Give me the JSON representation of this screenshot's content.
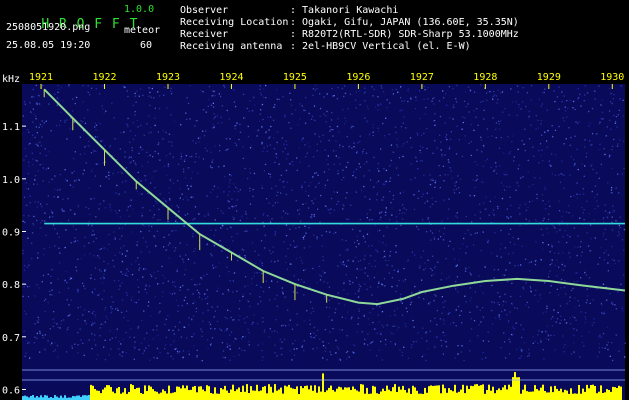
{
  "app": {
    "name": "H R O F F T",
    "version": "1.0.0"
  },
  "file": {
    "name": "2508051920.png",
    "datetime": "25.08.05 19:20"
  },
  "mode": {
    "label": "meteor",
    "value": "60"
  },
  "info": {
    "labels": [
      "Observer",
      "Receiving Location",
      "Receiver",
      "Receiving antenna"
    ],
    "values": [
      ": Takanori Kawachi",
      ": Ogaki, Gifu, JAPAN (136.60E, 35.35N)",
      ": R820T2(RTL-SDR) SDR-Sharp 53.1000MHz",
      ": 2el-HB9CV Vertical (el. E-W)"
    ]
  },
  "colors": {
    "background": "#0a0a5a",
    "noise": "#3a50c8",
    "header_text": "#ffffff",
    "title_text": "#30e030",
    "time_labels": "#ffff00",
    "freq_labels": "#ffffff",
    "carrier": "#33dddd",
    "meteor": "#9cf0a0",
    "level_bars": "#ffff00"
  },
  "chart_data": {
    "type": "heatmap",
    "ylabel": "kHz",
    "ytick_labels": [
      "1.1",
      "1.0",
      "0.9",
      "0.8",
      "0.7",
      "0.6"
    ],
    "yticks": [
      1.1,
      1.0,
      0.9,
      0.8,
      0.7,
      0.6
    ],
    "ylim": [
      0.58,
      1.18
    ],
    "xtick_labels": [
      "1921",
      "1922",
      "1923",
      "1924",
      "1925",
      "1926",
      "1927",
      "1928",
      "1929",
      "1930"
    ],
    "xticks": [
      1921,
      1922,
      1923,
      1924,
      1925,
      1926,
      1927,
      1928,
      1929,
      1930
    ],
    "xlim": [
      1920.7,
      1930.2
    ],
    "carrier_freq": 0.915,
    "meteor_trail": [
      {
        "t": 1921.05,
        "f": 1.17
      },
      {
        "t": 1921.5,
        "f": 1.115
      },
      {
        "t": 1922.0,
        "f": 1.055
      },
      {
        "t": 1922.5,
        "f": 0.995
      },
      {
        "t": 1923.0,
        "f": 0.945
      },
      {
        "t": 1923.5,
        "f": 0.895
      },
      {
        "t": 1924.0,
        "f": 0.86
      },
      {
        "t": 1924.5,
        "f": 0.825
      },
      {
        "t": 1925.0,
        "f": 0.8
      },
      {
        "t": 1925.5,
        "f": 0.78
      },
      {
        "t": 1926.0,
        "f": 0.765
      },
      {
        "t": 1926.3,
        "f": 0.762
      },
      {
        "t": 1926.7,
        "f": 0.772
      },
      {
        "t": 1927.0,
        "f": 0.785
      },
      {
        "t": 1927.5,
        "f": 0.797
      },
      {
        "t": 1928.0,
        "f": 0.806
      },
      {
        "t": 1928.5,
        "f": 0.81
      },
      {
        "t": 1929.0,
        "f": 0.806
      },
      {
        "t": 1929.5,
        "f": 0.798
      },
      {
        "t": 1930.2,
        "f": 0.788
      }
    ]
  }
}
